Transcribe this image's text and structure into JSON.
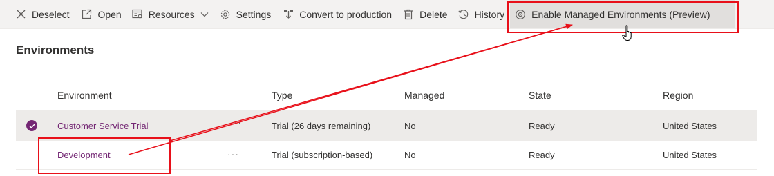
{
  "toolbar": {
    "deselect_label": "Deselect",
    "open_label": "Open",
    "resources_label": "Resources",
    "settings_label": "Settings",
    "convert_label": "Convert to production",
    "delete_label": "Delete",
    "history_label": "History",
    "enable_managed_label": "Enable Managed Environments (Preview)"
  },
  "page": {
    "title": "Environments"
  },
  "table": {
    "headers": {
      "environment": "Environment",
      "type": "Type",
      "managed": "Managed",
      "state": "State",
      "region": "Region"
    },
    "rows": [
      {
        "environment": "Customer Service Trial",
        "more": "···",
        "type": "Trial (26 days remaining)",
        "managed": "No",
        "state": "Ready",
        "region": "United States",
        "selected": true
      },
      {
        "environment": "Development",
        "more": "···",
        "type": "Trial (subscription-based)",
        "managed": "No",
        "state": "Ready",
        "region": "United States",
        "selected": false
      }
    ]
  },
  "colors": {
    "accent": "#742774",
    "annotation": "#e8101a",
    "toolbar_bg": "#f3f2f1",
    "selected_row": "#edebe9"
  },
  "icons": [
    "close-icon",
    "open-icon",
    "resources-icon",
    "chevron-down-icon",
    "gear-icon",
    "convert-icon",
    "trash-icon",
    "history-icon",
    "managed-env-icon",
    "pointer-cursor-icon",
    "checkmark-icon"
  ]
}
